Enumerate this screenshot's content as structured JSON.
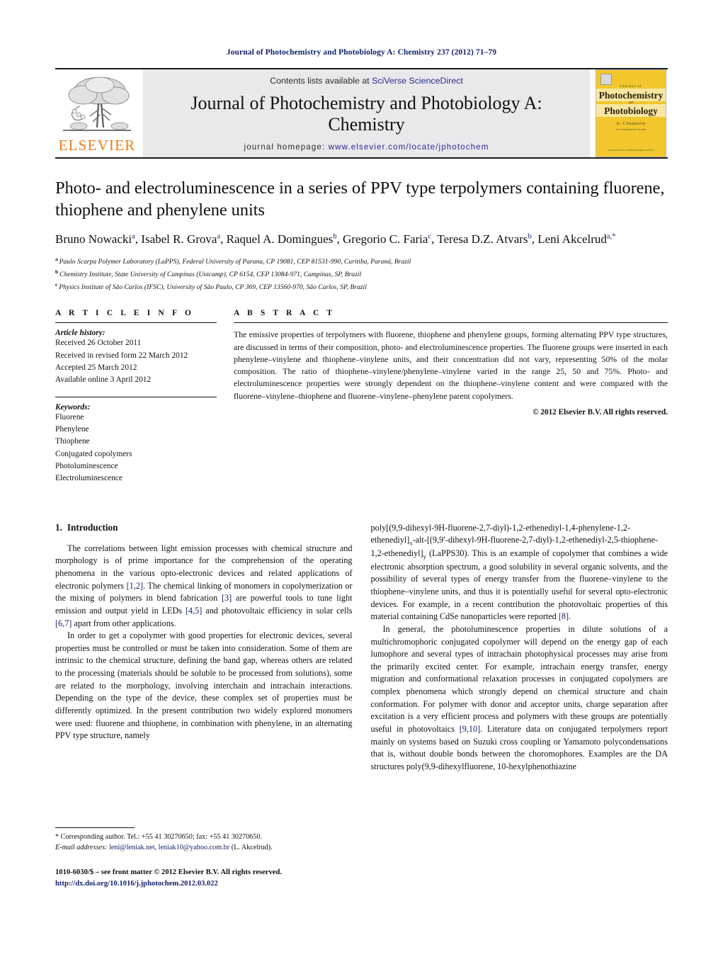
{
  "running_head": "Journal of Photochemistry and Photobiology A: Chemistry 237 (2012) 71–79",
  "masthead": {
    "publisher_name": "ELSEVIER",
    "contents_prefix": "Contents lists available at",
    "contents_link": "SciVerse ScienceDirect",
    "journal_title": "Journal of Photochemistry and Photobiology A: Chemistry",
    "homepage_prefix": "journal homepage:",
    "homepage_url": "www.elsevier.com/locate/jphotochem",
    "cover": {
      "journal_of": "Journal of",
      "line1": "Photochemistry",
      "and": "and",
      "line2": "Photobiology",
      "subtitle": "A: Chemistry",
      "subtitle2": "An International Journal",
      "footer": "www.elsevier.com/locate/jphotochem"
    },
    "accent_orange": "#ef7d16",
    "link_blue": "#2a2a8c",
    "banner_bg": "#e9e9ec",
    "cover_yellow": "#f2c72e"
  },
  "article": {
    "title": "Photo- and electroluminescence in a series of PPV type terpolymers containing fluorene, thiophene and phenylene units",
    "authors": [
      {
        "name": "Bruno Nowacki",
        "marks": "a",
        "sep": ", "
      },
      {
        "name": "Isabel R. Grova",
        "marks": "a",
        "sep": ", "
      },
      {
        "name": "Raquel A. Domingues",
        "marks": "b",
        "sep": ", "
      },
      {
        "name": "Gregorio C. Faria",
        "marks": "c",
        "sep": ", "
      },
      {
        "name": "Teresa D.Z. Atvars",
        "marks": "b",
        "sep": ", "
      },
      {
        "name": "Leni Akcelrud",
        "marks": "a,*",
        "sep": ""
      }
    ],
    "affiliations": [
      {
        "mark": "a",
        "text": "Paulo Scarpa Polymer Laboratory (LaPPS), Federal University of Parana, CP 19081, CEP 81531-990, Curitiba, Paraná, Brazil"
      },
      {
        "mark": "b",
        "text": "Chemistry Institute, State University of Campinas (Unicamp), CP 6154, CEP 13084-971, Campinas, SP, Brazil"
      },
      {
        "mark": "c",
        "text": "Physics Institute of São Carlos (IFSC), University of São Paulo, CP 369, CEP 13560-970, São Carlos, SP, Brazil"
      }
    ]
  },
  "article_info": {
    "heading": "A R T I C L E  I N F O",
    "history_label": "Article history:",
    "history": [
      "Received 26 October 2011",
      "Received in revised form 22 March 2012",
      "Accepted 25 March 2012",
      "Available online 3 April 2012"
    ],
    "keywords_label": "Keywords:",
    "keywords": [
      "Fluorene",
      "Phenylene",
      "Thiophene",
      "Conjugated copolymers",
      "Photoluminescence",
      "Electroluminescence"
    ]
  },
  "abstract": {
    "heading": "A B S T R A C T",
    "text": "The emissive properties of terpolymers with fluorene, thiophene and phenylene groups, forming alternating PPV type structures, are discussed in terms of their composition, photo- and electroluminescence properties. The fluorene groups were inserted in each phenylene–vinylene and thiophene–vinylene units, and their concentration did not vary, representing 50% of the molar composition. The ratio of thiophene–vinylene/phenylene–vinylene varied in the range 25, 50 and 75%. Photo- and electroluminescence properties were strongly dependent on the thiophene–vinylene content and were compared with the fluorene–vinylene–thiophene and fluorene–vinylene–phenylene parent copolymers.",
    "copyright": "© 2012 Elsevier B.V. All rights reserved."
  },
  "body": {
    "section_number": "1.",
    "section_title": "Introduction",
    "left_paragraphs": [
      {
        "parts": [
          {
            "t": "The correlations between light emission processes with chemical structure and morphology is of prime importance for the comprehension of the operating phenomena in the various opto-electronic devices and related applications of electronic polymers "
          },
          {
            "t": "[1,2]",
            "cite": true
          },
          {
            "t": ". The chemical linking of monomers in copolymerization or the mixing of polymers in blend fabrication "
          },
          {
            "t": "[3]",
            "cite": true
          },
          {
            "t": " are powerful tools to tune light emission and output yield in LEDs "
          },
          {
            "t": "[4,5]",
            "cite": true
          },
          {
            "t": " and photovoltaic efficiency in solar cells "
          },
          {
            "t": "[6,7]",
            "cite": true
          },
          {
            "t": " apart from other applications."
          }
        ]
      },
      {
        "parts": [
          {
            "t": "In order to get a copolymer with good properties for electronic devices, several properties must be controlled or must be taken into consideration. Some of them are intrinsic to the chemical structure, defining the band gap, whereas others are related to the processing (materials should be soluble to be processed from solutions), some are related to the morphology, involving interchain and intrachain interactions. Depending on the type of the device, these complex set of properties must be differently optimized. In the present contribution two widely explored monomers were used: fluorene and thiophene, in combination with phenylene, in an alternating PPV type structure, namely"
          }
        ]
      }
    ],
    "right_paragraphs": [
      {
        "no_indent": true,
        "parts": [
          {
            "t": "poly[(9,9-dihexyl-9H-fluorene-2,7-diyl)-1,2-ethenediyl-1,4-phenylene-1,2-ethenediyl]"
          },
          {
            "t": "x",
            "sub": true
          },
          {
            "t": "-alt-[(9,9′-dihexyl-9H-fluorene-2,7-diyl)-1,2-ethenediyl-2,5-thiophene-1,2-ethenediyl]"
          },
          {
            "t": "y",
            "sub": true
          },
          {
            "t": "  (LaPPS30). This is an example of copolymer that combines a wide electronic absorption spectrum, a good solubility in several organic solvents, and the possibility of several types of energy transfer from the fluorene–vinylene to the thiophene–vinylene units, and thus it is potentially useful for several opto-electronic devices. For example, in a recent contribution the photovoltaic properties of this material containing CdSe nanoparticles were reported "
          },
          {
            "t": "[8]",
            "cite": true
          },
          {
            "t": "."
          }
        ]
      },
      {
        "parts": [
          {
            "t": "In general, the photoluminescence properties in dilute solutions of a multichromophoric conjugated copolymer will depend on the energy gap of each lumophore and several types of intrachain photophysical processes may arise from the primarily excited center. For example, intrachain energy transfer, energy migration and conformational relaxation processes in conjugated copolymers are complex phenomena which strongly depend on chemical structure and chain conformation. For polymer with donor and acceptor units, charge separation after excitation is a very efficient process and polymers with these groups are potentially useful in photovoltaics "
          },
          {
            "t": "[9,10]",
            "cite": true
          },
          {
            "t": ". Literature data on conjugated terpolymers report mainly on systems based on Suzuki cross coupling or Yamamoto polycondensations that is, without double bonds between the choromophores. Examples are the DA structures poly(9,9-dihexylfluorene, 10-hexylphenothiazine"
          }
        ]
      }
    ]
  },
  "footnote": {
    "marker": "*",
    "corresponding": "Corresponding author. Tel.: +55 41 30270650; fax: +55 41 30270650.",
    "email_label": "E-mail addresses:",
    "email1": "leni@leniak.net",
    "email_sep": ", ",
    "email2": "leniak10@yahoo.com.br",
    "email_suffix": " (L. Akcelrud)."
  },
  "bottom": {
    "front_matter": "1010-6030/$ – see front matter © 2012 Elsevier B.V. All rights reserved.",
    "doi": "http://dx.doi.org/10.1016/j.jphotochem.2012.03.022"
  }
}
